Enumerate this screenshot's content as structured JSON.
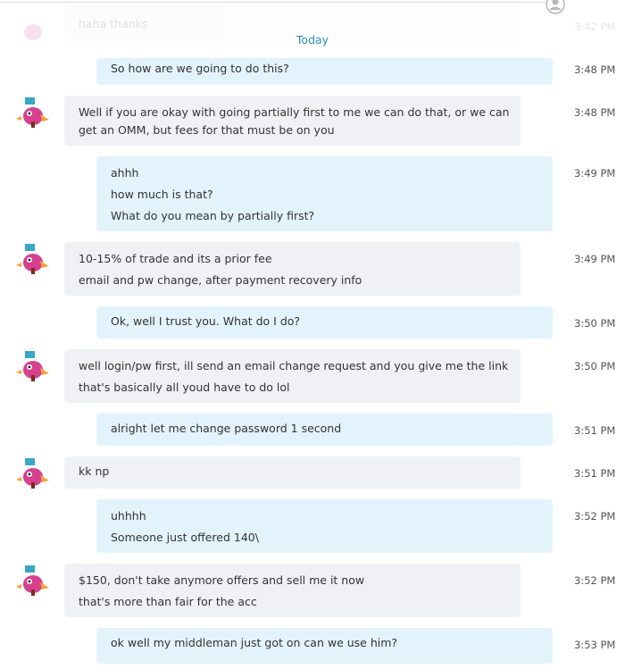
{
  "header": {
    "day_label": "Today"
  },
  "faded": {
    "text": "haha thanks",
    "time": "3:42 PM"
  },
  "messages": [
    {
      "dir": "out",
      "time": "3:48 PM",
      "lines": [
        "So how are we going to do this?"
      ]
    },
    {
      "dir": "in",
      "time": "3:48 PM",
      "lines": [
        "Well if you are okay with going partially first to me we can do that, or we can",
        "get an OMM, but fees for that must be on you"
      ]
    },
    {
      "dir": "out",
      "time": "3:49 PM",
      "lines": [
        "ahhh",
        "how much is that?",
        "What do you mean by partially first?"
      ]
    },
    {
      "dir": "in",
      "time": "3:49 PM",
      "lines": [
        "10-15% of trade and its a prior fee",
        "email and pw change, after payment recovery info"
      ]
    },
    {
      "dir": "out",
      "time": "3:50 PM",
      "lines": [
        "Ok, well I trust you. What do I do?"
      ]
    },
    {
      "dir": "in",
      "time": "3:50 PM",
      "lines": [
        "well login/pw first, ill send an email change request and you give me the link",
        "that's basically all youd have to do lol"
      ]
    },
    {
      "dir": "out",
      "time": "3:51 PM",
      "lines": [
        "alright let me change password 1 second"
      ]
    },
    {
      "dir": "in",
      "time": "3:51 PM",
      "lines": [
        "kk np"
      ]
    },
    {
      "dir": "out",
      "time": "3:52 PM",
      "lines": [
        "uhhhh",
        "Someone just offered 140\\"
      ]
    },
    {
      "dir": "in",
      "time": "3:52 PM",
      "lines": [
        "$150, don't take anymore offers and sell me it now",
        "that's more than fair for the acc"
      ]
    },
    {
      "dir": "out",
      "time": "3:53 PM",
      "lines": [
        "ok well my middleman just got on can we use him?"
      ]
    }
  ],
  "icons": {
    "avatar": "bird-avatar-icon",
    "top": "contact-icon"
  }
}
